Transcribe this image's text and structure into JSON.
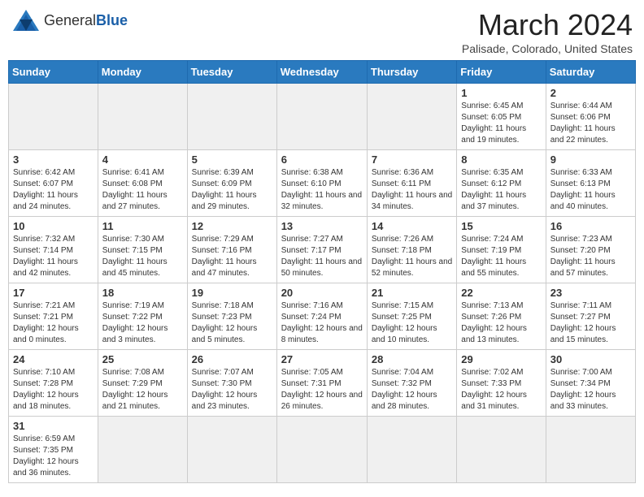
{
  "header": {
    "logo_general": "General",
    "logo_blue": "Blue",
    "month_title": "March 2024",
    "subtitle": "Palisade, Colorado, United States"
  },
  "days_of_week": [
    "Sunday",
    "Monday",
    "Tuesday",
    "Wednesday",
    "Thursday",
    "Friday",
    "Saturday"
  ],
  "weeks": [
    [
      {
        "day": "",
        "info": ""
      },
      {
        "day": "",
        "info": ""
      },
      {
        "day": "",
        "info": ""
      },
      {
        "day": "",
        "info": ""
      },
      {
        "day": "",
        "info": ""
      },
      {
        "day": "1",
        "info": "Sunrise: 6:45 AM\nSunset: 6:05 PM\nDaylight: 11 hours and 19 minutes."
      },
      {
        "day": "2",
        "info": "Sunrise: 6:44 AM\nSunset: 6:06 PM\nDaylight: 11 hours and 22 minutes."
      }
    ],
    [
      {
        "day": "3",
        "info": "Sunrise: 6:42 AM\nSunset: 6:07 PM\nDaylight: 11 hours and 24 minutes."
      },
      {
        "day": "4",
        "info": "Sunrise: 6:41 AM\nSunset: 6:08 PM\nDaylight: 11 hours and 27 minutes."
      },
      {
        "day": "5",
        "info": "Sunrise: 6:39 AM\nSunset: 6:09 PM\nDaylight: 11 hours and 29 minutes."
      },
      {
        "day": "6",
        "info": "Sunrise: 6:38 AM\nSunset: 6:10 PM\nDaylight: 11 hours and 32 minutes."
      },
      {
        "day": "7",
        "info": "Sunrise: 6:36 AM\nSunset: 6:11 PM\nDaylight: 11 hours and 34 minutes."
      },
      {
        "day": "8",
        "info": "Sunrise: 6:35 AM\nSunset: 6:12 PM\nDaylight: 11 hours and 37 minutes."
      },
      {
        "day": "9",
        "info": "Sunrise: 6:33 AM\nSunset: 6:13 PM\nDaylight: 11 hours and 40 minutes."
      }
    ],
    [
      {
        "day": "10",
        "info": "Sunrise: 7:32 AM\nSunset: 7:14 PM\nDaylight: 11 hours and 42 minutes."
      },
      {
        "day": "11",
        "info": "Sunrise: 7:30 AM\nSunset: 7:15 PM\nDaylight: 11 hours and 45 minutes."
      },
      {
        "day": "12",
        "info": "Sunrise: 7:29 AM\nSunset: 7:16 PM\nDaylight: 11 hours and 47 minutes."
      },
      {
        "day": "13",
        "info": "Sunrise: 7:27 AM\nSunset: 7:17 PM\nDaylight: 11 hours and 50 minutes."
      },
      {
        "day": "14",
        "info": "Sunrise: 7:26 AM\nSunset: 7:18 PM\nDaylight: 11 hours and 52 minutes."
      },
      {
        "day": "15",
        "info": "Sunrise: 7:24 AM\nSunset: 7:19 PM\nDaylight: 11 hours and 55 minutes."
      },
      {
        "day": "16",
        "info": "Sunrise: 7:23 AM\nSunset: 7:20 PM\nDaylight: 11 hours and 57 minutes."
      }
    ],
    [
      {
        "day": "17",
        "info": "Sunrise: 7:21 AM\nSunset: 7:21 PM\nDaylight: 12 hours and 0 minutes."
      },
      {
        "day": "18",
        "info": "Sunrise: 7:19 AM\nSunset: 7:22 PM\nDaylight: 12 hours and 3 minutes."
      },
      {
        "day": "19",
        "info": "Sunrise: 7:18 AM\nSunset: 7:23 PM\nDaylight: 12 hours and 5 minutes."
      },
      {
        "day": "20",
        "info": "Sunrise: 7:16 AM\nSunset: 7:24 PM\nDaylight: 12 hours and 8 minutes."
      },
      {
        "day": "21",
        "info": "Sunrise: 7:15 AM\nSunset: 7:25 PM\nDaylight: 12 hours and 10 minutes."
      },
      {
        "day": "22",
        "info": "Sunrise: 7:13 AM\nSunset: 7:26 PM\nDaylight: 12 hours and 13 minutes."
      },
      {
        "day": "23",
        "info": "Sunrise: 7:11 AM\nSunset: 7:27 PM\nDaylight: 12 hours and 15 minutes."
      }
    ],
    [
      {
        "day": "24",
        "info": "Sunrise: 7:10 AM\nSunset: 7:28 PM\nDaylight: 12 hours and 18 minutes."
      },
      {
        "day": "25",
        "info": "Sunrise: 7:08 AM\nSunset: 7:29 PM\nDaylight: 12 hours and 21 minutes."
      },
      {
        "day": "26",
        "info": "Sunrise: 7:07 AM\nSunset: 7:30 PM\nDaylight: 12 hours and 23 minutes."
      },
      {
        "day": "27",
        "info": "Sunrise: 7:05 AM\nSunset: 7:31 PM\nDaylight: 12 hours and 26 minutes."
      },
      {
        "day": "28",
        "info": "Sunrise: 7:04 AM\nSunset: 7:32 PM\nDaylight: 12 hours and 28 minutes."
      },
      {
        "day": "29",
        "info": "Sunrise: 7:02 AM\nSunset: 7:33 PM\nDaylight: 12 hours and 31 minutes."
      },
      {
        "day": "30",
        "info": "Sunrise: 7:00 AM\nSunset: 7:34 PM\nDaylight: 12 hours and 33 minutes."
      }
    ],
    [
      {
        "day": "31",
        "info": "Sunrise: 6:59 AM\nSunset: 7:35 PM\nDaylight: 12 hours and 36 minutes."
      },
      {
        "day": "",
        "info": ""
      },
      {
        "day": "",
        "info": ""
      },
      {
        "day": "",
        "info": ""
      },
      {
        "day": "",
        "info": ""
      },
      {
        "day": "",
        "info": ""
      },
      {
        "day": "",
        "info": ""
      }
    ]
  ]
}
